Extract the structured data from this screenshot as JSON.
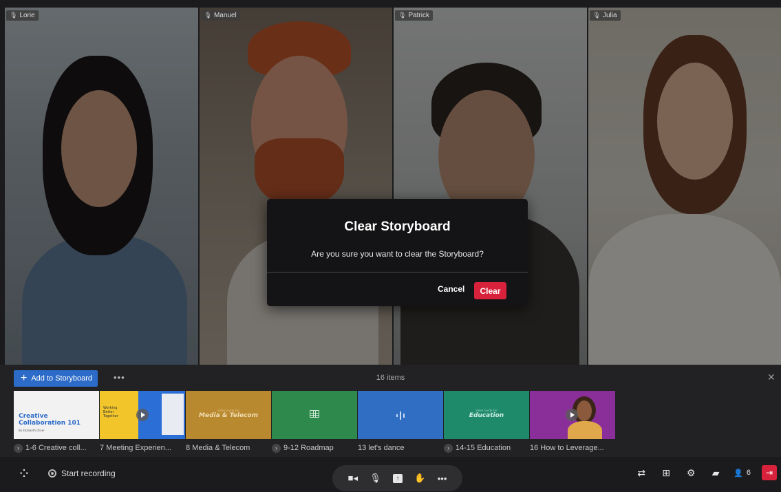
{
  "participants": [
    {
      "name": "Lorie"
    },
    {
      "name": "Manuel"
    },
    {
      "name": "Patrick"
    },
    {
      "name": "Julia"
    }
  ],
  "dialog": {
    "title": "Clear Storyboard",
    "message": "Are you sure you want to clear the Storyboard?",
    "cancel_label": "Cancel",
    "confirm_label": "Clear"
  },
  "storyboard": {
    "add_label": "Add to Storyboard",
    "count_label": "16 items",
    "thumbnails": [
      {
        "title_line1": "Creative",
        "title_line2": "Collaboration 101",
        "subtitle": "By Elizabeth Oliver"
      },
      {
        "text": "Working Better Together"
      },
      {
        "text": "Media & Telecom",
        "eyebrow": "Video Guide For"
      },
      {
        "icon": "grid-icon"
      },
      {
        "icon": "audio-icon"
      },
      {
        "text": "Education",
        "eyebrow": "Video Guide For"
      },
      {
        "icon": "play-icon"
      }
    ],
    "items": [
      {
        "label": "1-6 Creative coll...",
        "expandable": true
      },
      {
        "label": "7 Meeting Experien...",
        "expandable": false
      },
      {
        "label": "8 Media & Telecom",
        "expandable": false
      },
      {
        "label": "9-12 Roadmap",
        "expandable": true
      },
      {
        "label": "13 let's dance",
        "expandable": false
      },
      {
        "label": "14-15 Education",
        "expandable": true
      },
      {
        "label": "16 How to Leverage...",
        "expandable": false
      }
    ]
  },
  "toolbar": {
    "record_label": "Start recording",
    "participant_count": "6"
  },
  "colors": {
    "accent": "#2c6bc8",
    "danger": "#d8213a"
  }
}
